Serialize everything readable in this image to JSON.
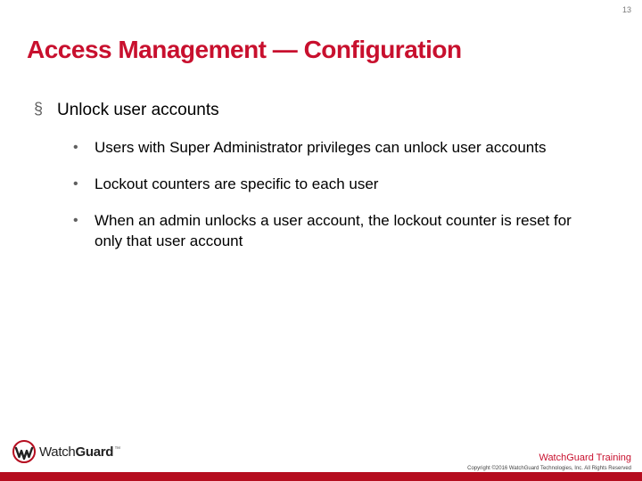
{
  "page_number": "13",
  "title": "Access Management — Configuration",
  "bullets": {
    "lvl1": "Unlock user accounts",
    "lvl2": [
      "Users with Super Administrator privileges can unlock user accounts",
      "Lockout counters are specific to each user",
      "When an admin unlocks a user account, the lockout counter is reset for only that user account"
    ]
  },
  "bullet_glyph_lvl1": "§",
  "bullet_glyph_lvl2": "•",
  "footer": {
    "brand_first": "Watch",
    "brand_second": "Guard",
    "training": "WatchGuard Training",
    "copyright": "Copyright ©2016 WatchGuard Technologies, Inc. All Rights Reserved"
  },
  "colors": {
    "accent": "#c8102e",
    "bar": "#b50d1f"
  }
}
